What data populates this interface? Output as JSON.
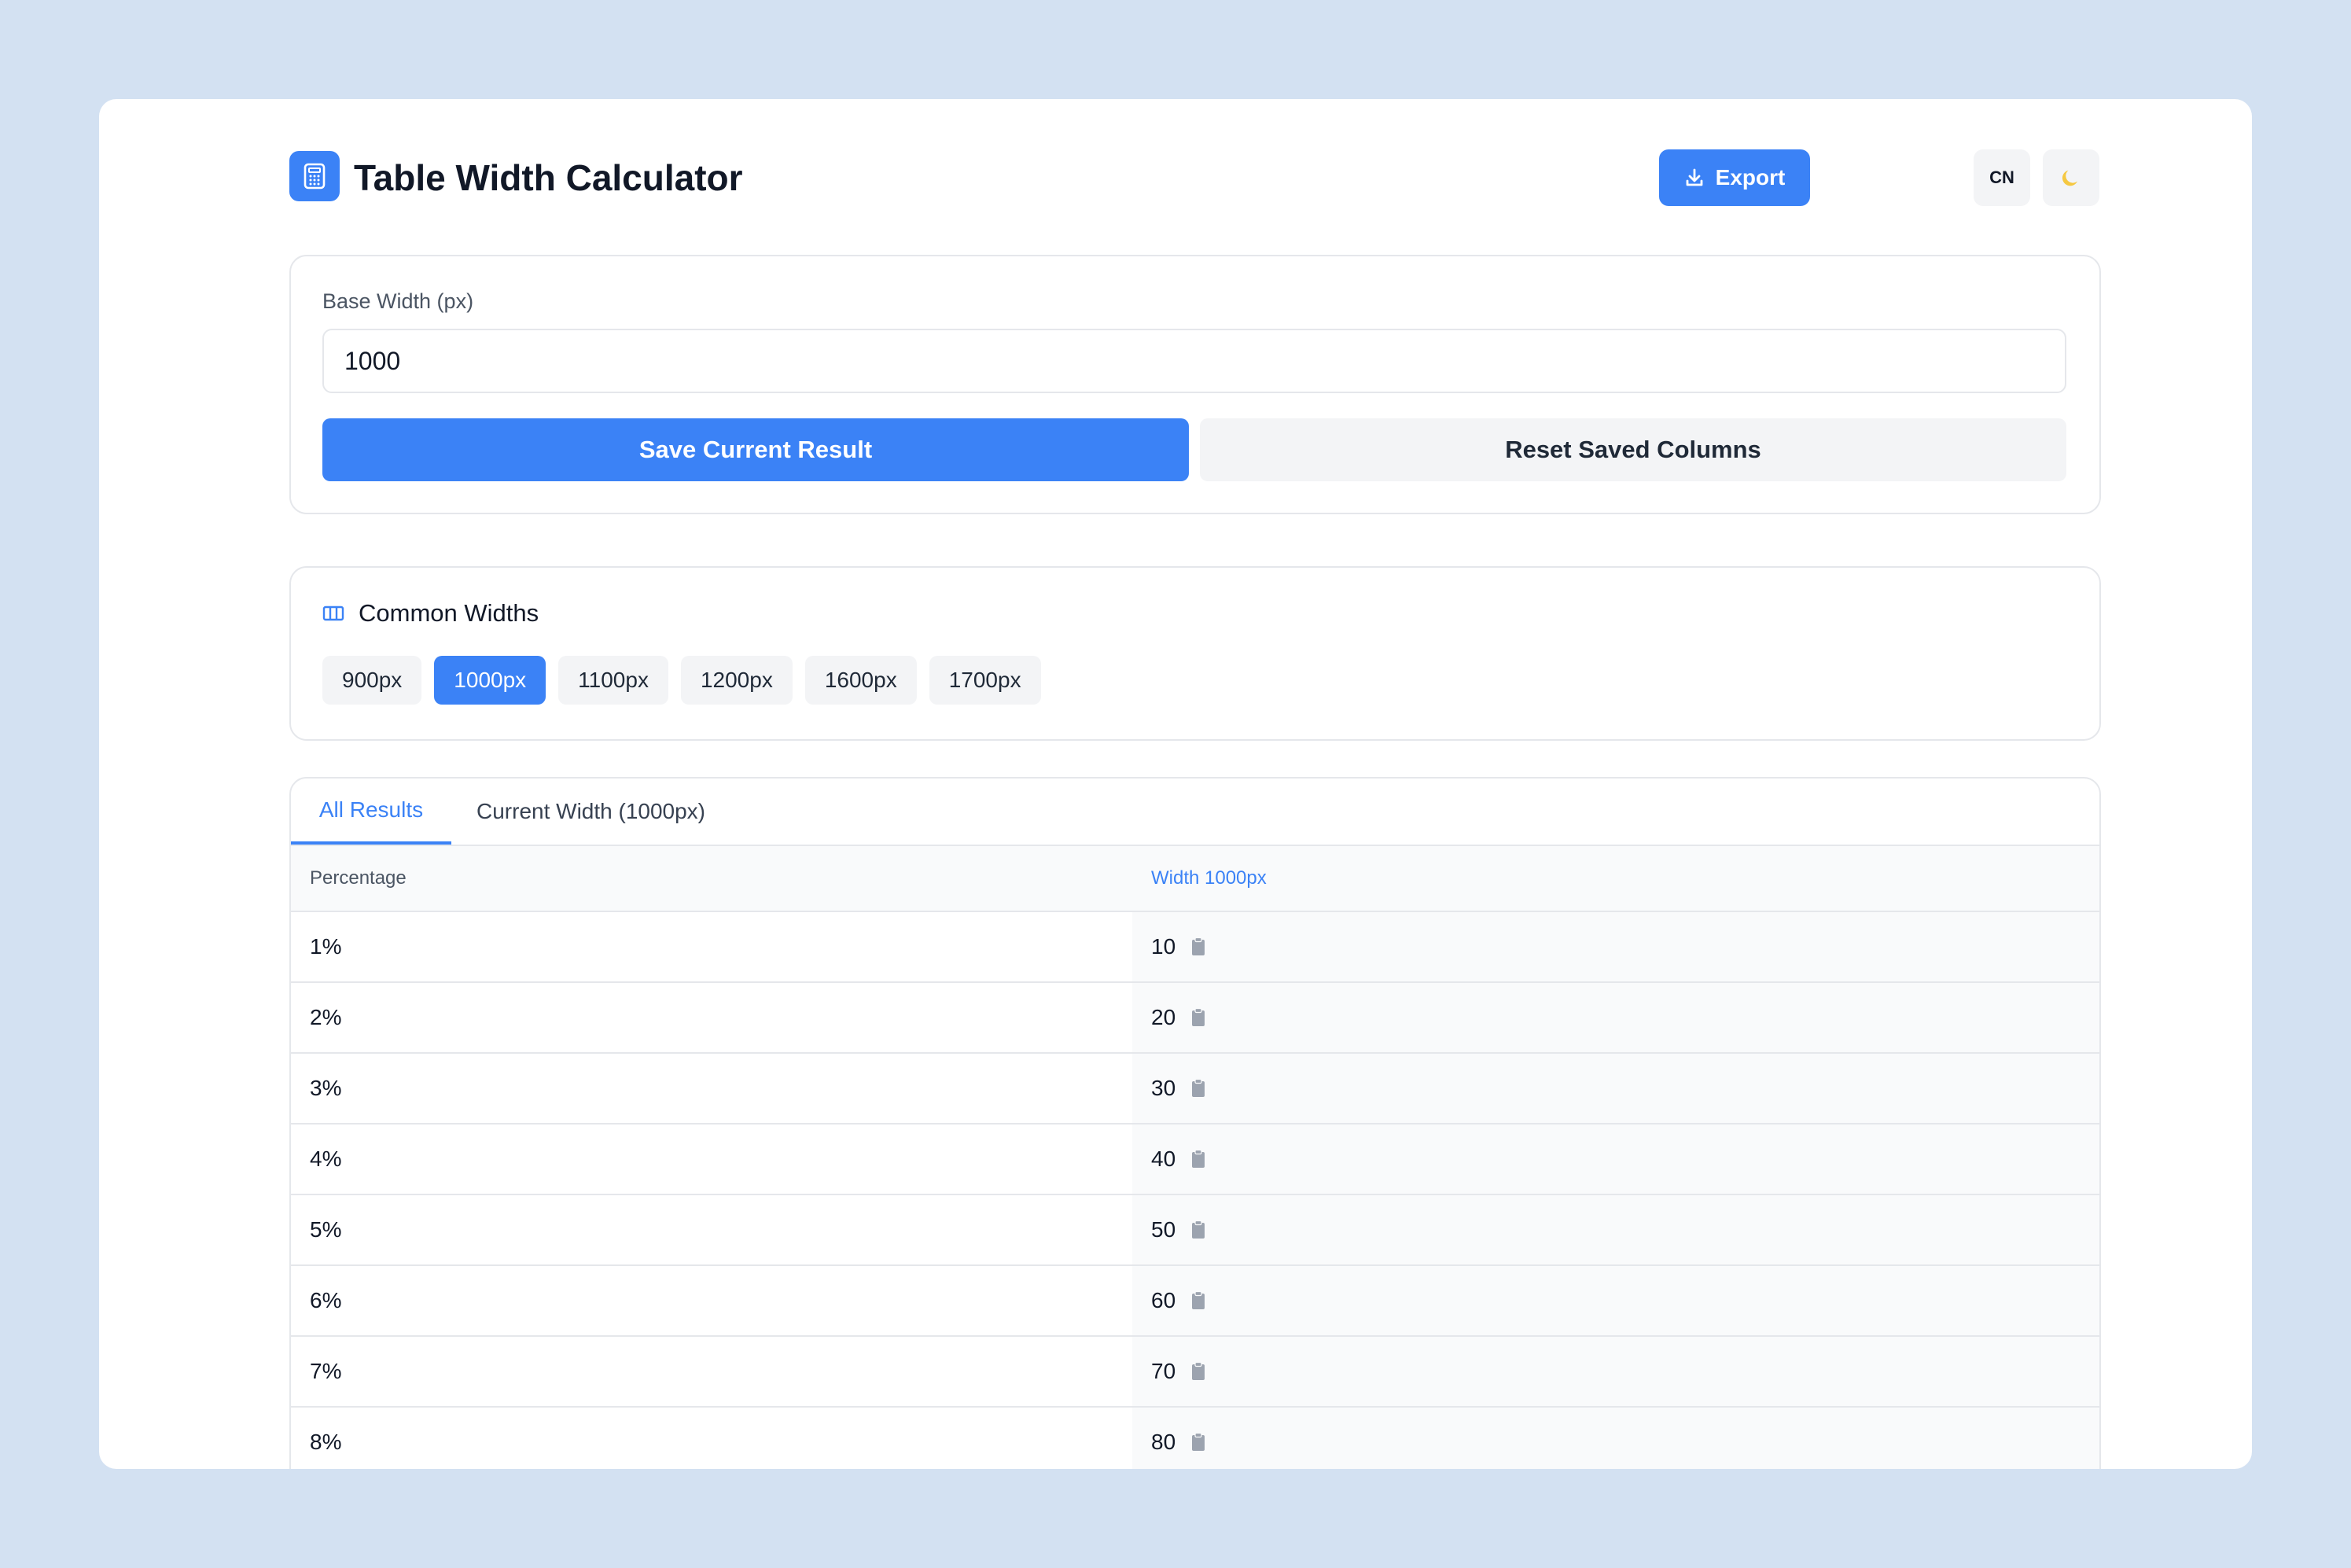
{
  "header": {
    "title": "Table Width Calculator",
    "export_label": "Export",
    "lang_label": "CN",
    "icons": {
      "app": "calculator-icon",
      "export": "download-icon",
      "theme": "moon-icon"
    }
  },
  "base_width": {
    "label": "Base Width (px)",
    "value": "1000"
  },
  "actions": {
    "save_label": "Save Current Result",
    "reset_label": "Reset Saved Columns"
  },
  "common_widths": {
    "title": "Common Widths",
    "icon": "columns-icon",
    "options": [
      "900px",
      "1000px",
      "1100px",
      "1200px",
      "1600px",
      "1700px"
    ],
    "selected": "1000px"
  },
  "results": {
    "tabs": [
      "All Results",
      "Current Width (1000px)"
    ],
    "active_tab": "All Results",
    "columns": [
      "Percentage",
      "Width 1000px"
    ],
    "rows": [
      {
        "pct": "1%",
        "value": "10"
      },
      {
        "pct": "2%",
        "value": "20"
      },
      {
        "pct": "3%",
        "value": "30"
      },
      {
        "pct": "4%",
        "value": "40"
      },
      {
        "pct": "5%",
        "value": "50"
      },
      {
        "pct": "6%",
        "value": "60"
      },
      {
        "pct": "7%",
        "value": "70"
      },
      {
        "pct": "8%",
        "value": "80"
      }
    ],
    "row_icon": "clipboard-icon"
  },
  "colors": {
    "accent": "#3b82f6",
    "background": "#d3e1f2",
    "surface": "#ffffff",
    "muted_button": "#f3f4f6",
    "border": "#e5e7eb"
  }
}
